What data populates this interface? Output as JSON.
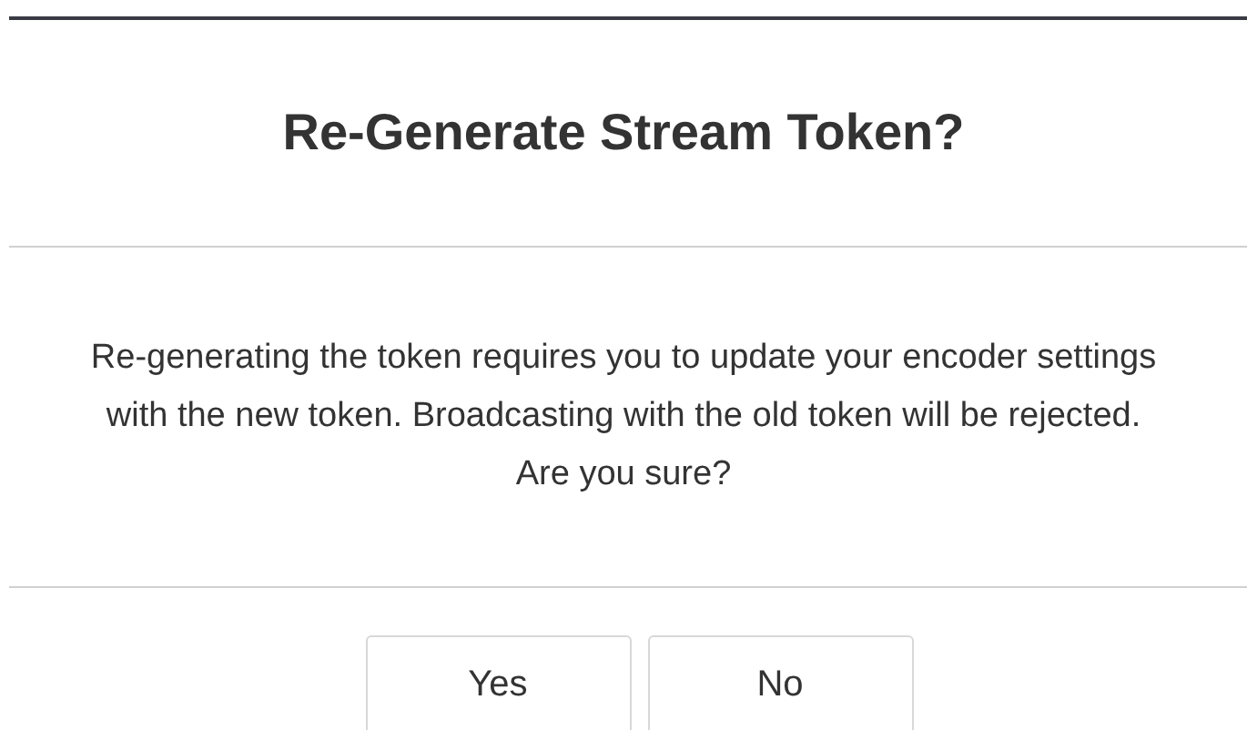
{
  "dialog": {
    "title": "Re-Generate Stream Token?",
    "message": "Re-generating the token requires you to update your encoder settings with the new token. Broadcasting with the old token will be rejected. Are you sure?",
    "buttons": [
      "Yes",
      "No"
    ]
  }
}
